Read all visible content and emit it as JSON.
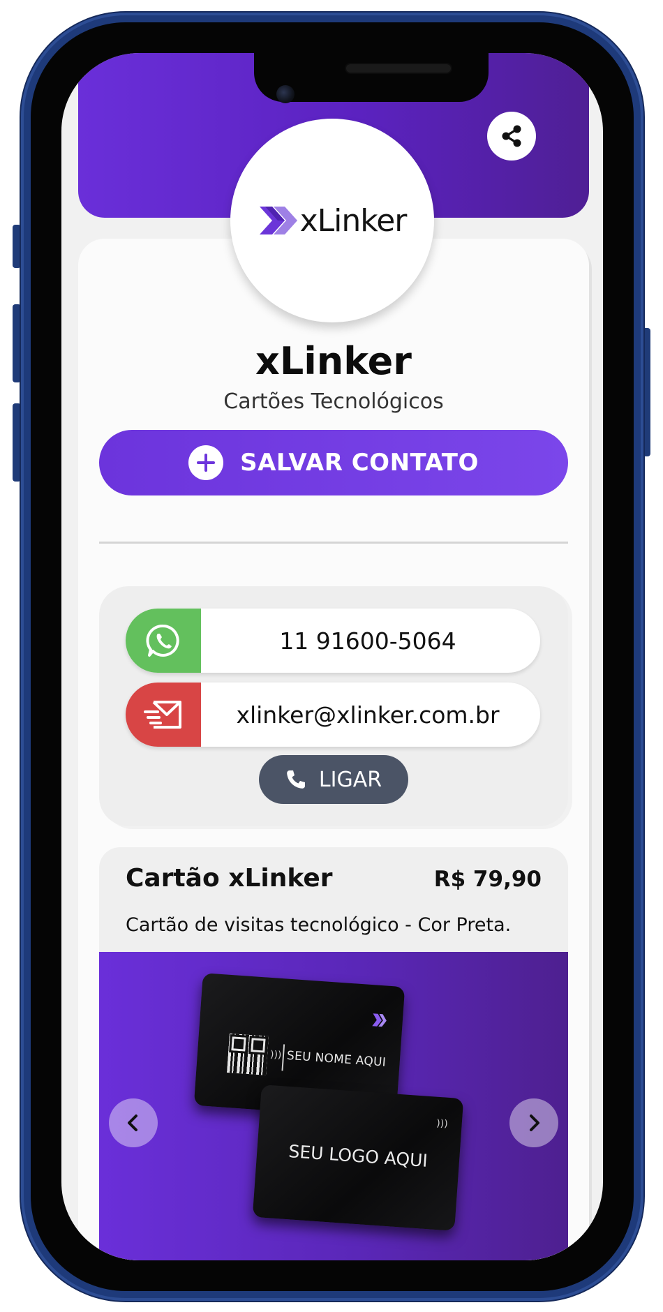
{
  "profile": {
    "logo_text": "xLinker",
    "name": "xLinker",
    "subtitle": "Cartões Tecnológicos"
  },
  "actions": {
    "save_contact_label": "SALVAR CONTATO",
    "call_label": "LIGAR"
  },
  "contacts": {
    "whatsapp": "11 91600-5064",
    "email": "xlinker@xlinker.com.br"
  },
  "product": {
    "title": "Cartão xLinker",
    "price": "R$ 79,90",
    "description": "Cartão de visitas tecnológico - Cor Preta.",
    "card_back_text": "SEU NOME AQUI",
    "card_front_text": "SEU LOGO AQUI"
  },
  "colors": {
    "brand_purple": "#6a2fd9",
    "whatsapp_green": "#63c05d",
    "email_red": "#d84545",
    "call_gray": "#4b5466"
  },
  "icons": {
    "share": "share-icon",
    "add": "plus-circle-icon",
    "whatsapp": "whatsapp-icon",
    "email": "email-icon",
    "phone": "phone-icon",
    "prev": "chevron-left-icon",
    "next": "chevron-right-icon"
  }
}
